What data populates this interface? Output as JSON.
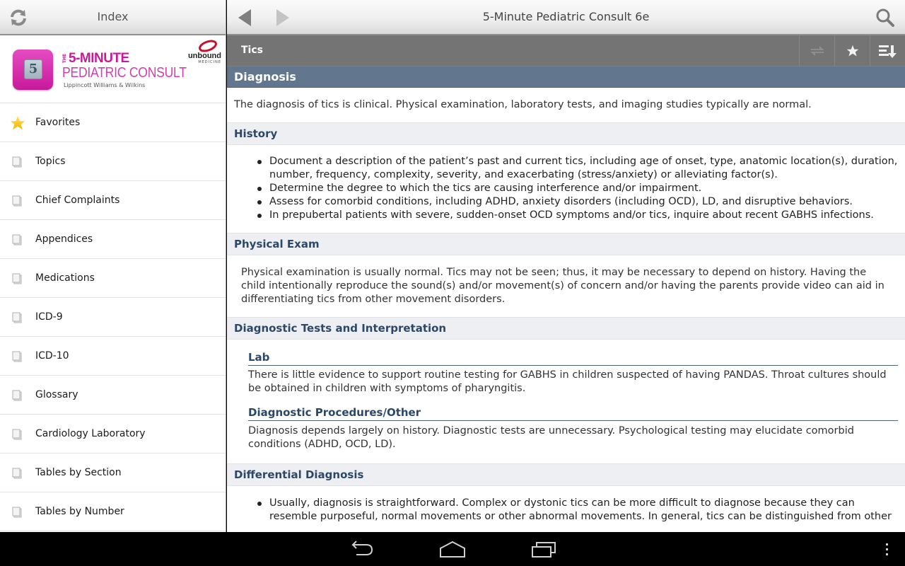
{
  "index_pane": {
    "title": "Index",
    "refresh_icon": "refresh-icon",
    "logo": {
      "the": "THE",
      "line1": "5-MINUTE",
      "line2": "PEDIATRIC CONSULT",
      "publisher": "Lippincott Williams & Wilkins",
      "cube_number": "5",
      "brand_name": "unbound",
      "brand_sub": "MEDICINE"
    },
    "items": [
      {
        "label": "Favorites",
        "icon": "star-icon"
      },
      {
        "label": "Topics",
        "icon": "document-stack-icon"
      },
      {
        "label": "Chief Complaints",
        "icon": "document-stack-icon"
      },
      {
        "label": "Appendices",
        "icon": "document-stack-icon"
      },
      {
        "label": "Medications",
        "icon": "document-stack-icon"
      },
      {
        "label": "ICD-9",
        "icon": "document-stack-icon"
      },
      {
        "label": "ICD-10",
        "icon": "document-stack-icon"
      },
      {
        "label": "Glossary",
        "icon": "document-stack-icon"
      },
      {
        "label": "Cardiology Laboratory",
        "icon": "document-stack-icon"
      },
      {
        "label": "Tables by Section",
        "icon": "document-stack-icon"
      },
      {
        "label": "Tables by Number",
        "icon": "document-stack-icon"
      }
    ]
  },
  "content_pane": {
    "title": "5-Minute Pediatric Consult 6e",
    "topic": "Tics",
    "toolbar": {
      "link_icon": "swap-arrows-icon",
      "favorite_icon": "star-icon",
      "sections_icon": "section-menu-icon"
    },
    "main_section": "Diagnosis",
    "intro": "The diagnosis of tics is clinical. Physical examination, laboratory tests, and imaging studies typically are normal.",
    "history": {
      "heading": "History",
      "bullets": [
        "Document a description of the patient’s past and current tics, including age of onset, type, anatomic location(s), duration, number, frequency, complexity, severity, and exacerbating (stress/anxiety) or alleviating factor(s).",
        "Determine the degree to which the tics are causing interference and/or impairment.",
        "Assess for comorbid conditions, including ADHD, anxiety disorders (including OCD), LD, and disruptive behaviors.",
        "In prepubertal patients with severe, sudden-onset OCD symptoms and/or tics, inquire about recent GABHS infections."
      ]
    },
    "physical_exam": {
      "heading": "Physical Exam",
      "text": "Physical examination is usually normal. Tics may not be seen; thus, it may be necessary to depend on history. Having the child intentionally reproduce the sound(s) and/or movement(s) of concern and/or having the parents provide video can aid in differentiating tics from other movement disorders."
    },
    "diagnostic_tests": {
      "heading": "Diagnostic Tests and Interpretation",
      "lab_heading": "Lab",
      "lab_text": "There is little evidence to support routine testing for GABHS in children suspected of having PANDAS. Throat cultures should be obtained in children with symptoms of pharyngitis.",
      "procedures_heading": "Diagnostic Procedures/Other",
      "procedures_text": "Diagnosis depends largely on history. Diagnostic tests are unnecessary. Psychological testing may elucidate comorbid conditions (ADHD, OCD, LD)."
    },
    "differential": {
      "heading": "Differential Diagnosis",
      "bullets": [
        "Usually, diagnosis is straightforward. Complex or dystonic tics can be more difficult to diagnose because they can resemble purposeful, normal movements or other abnormal movements. In general, tics can be distinguished from other"
      ]
    }
  },
  "system_bar": {
    "back": "back-icon",
    "home": "home-icon",
    "recents": "recent-apps-icon",
    "menu": "overflow-menu-icon"
  },
  "colors": {
    "section_bar": "#62778d",
    "topic_bar": "#747474",
    "heading_text": "#2c4869",
    "logo_magenta": "#c61a9a"
  }
}
